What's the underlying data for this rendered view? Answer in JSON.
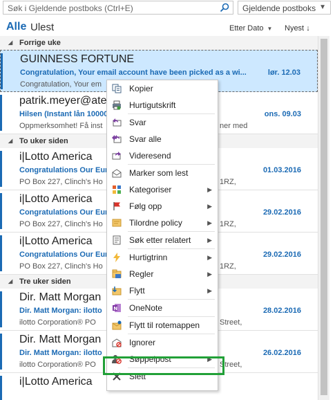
{
  "search": {
    "placeholder": "Søk i Gjeldende postboks (Ctrl+E)",
    "scope": "Gjeldende postboks"
  },
  "filters": {
    "all": "Alle",
    "unread": "Ulest",
    "sort_by": "Etter Dato",
    "sort_order": "Nyest"
  },
  "groups": [
    "Forrige uke",
    "To uker siden",
    "Tre uker siden"
  ],
  "emails": [
    {
      "sender": "GUINNESS FORTUNE",
      "subject": "Congratulation, Your email account have been picked as a wi...",
      "date": "lør. 12.03",
      "preview": "Congratulation, Your em",
      "preview_right": ""
    },
    {
      "sender": "patrik.meyer@atelie",
      "subject": "Hilsen (Instant lån 10000",
      "date": "ons. 09.03",
      "preview": "Oppmerksomhet! Få inst",
      "preview_right": "ner med"
    },
    {
      "sender": "i|Lotto America",
      "subject": "Congratulations Our Eur",
      "date": "01.03.2016",
      "preview": "PO Box 227,  Clinch's Ho",
      "preview_right": "1RZ,"
    },
    {
      "sender": "i|Lotto America",
      "subject": "Congratulations Our Eur",
      "date": "29.02.2016",
      "preview": "PO Box 227,  Clinch's Ho",
      "preview_right": "1RZ,"
    },
    {
      "sender": "i|Lotto America",
      "subject": "Congratulations Our Eur",
      "date": "29.02.2016",
      "preview": "PO Box 227,  Clinch's Ho",
      "preview_right": "1RZ,"
    },
    {
      "sender": "Dir. Matt Morgan",
      "subject": "Dir. Matt Morgan: ilotto",
      "date": "28.02.2016",
      "preview": "ilotto Corporation®   PO",
      "preview_right": "Street,"
    },
    {
      "sender": "Dir. Matt Morgan",
      "subject": "Dir. Matt Morgan: ilotto",
      "date": "26.02.2016",
      "preview": "ilotto Corporation®   PO",
      "preview_right": "Street,"
    },
    {
      "sender": "i|Lotto America",
      "subject": "",
      "date": "",
      "preview": "",
      "preview_right": ""
    }
  ],
  "menu": [
    {
      "label": "Kopier",
      "icon": "copy-icon",
      "submenu": false
    },
    {
      "label": "Hurtigutskrift",
      "icon": "print-icon",
      "submenu": false
    },
    {
      "label": "Svar",
      "icon": "reply-icon",
      "submenu": false
    },
    {
      "label": "Svar alle",
      "icon": "reply-all-icon",
      "submenu": false
    },
    {
      "label": "Videresend",
      "icon": "forward-icon",
      "submenu": false
    },
    {
      "label": "Marker som lest",
      "icon": "mark-read-icon",
      "submenu": false
    },
    {
      "label": "Kategoriser",
      "icon": "categorize-icon",
      "submenu": true
    },
    {
      "label": "Følg opp",
      "icon": "flag-icon",
      "submenu": true
    },
    {
      "label": "Tilordne policy",
      "icon": "policy-icon",
      "submenu": true
    },
    {
      "label": "Søk etter relatert",
      "icon": "find-related-icon",
      "submenu": true
    },
    {
      "label": "Hurtigtrinn",
      "icon": "quick-steps-icon",
      "submenu": true
    },
    {
      "label": "Regler",
      "icon": "rules-icon",
      "submenu": true
    },
    {
      "label": "Flytt",
      "icon": "move-icon",
      "submenu": true
    },
    {
      "label": "OneNote",
      "icon": "onenote-icon",
      "submenu": false
    },
    {
      "label": "Flytt til rotemappen",
      "icon": "clutter-icon",
      "submenu": false
    },
    {
      "label": "Ignorer",
      "icon": "ignore-icon",
      "submenu": false
    },
    {
      "label": "Søppelpost",
      "icon": "junk-icon",
      "submenu": true
    },
    {
      "label": "Slett",
      "icon": "delete-icon",
      "submenu": false
    }
  ],
  "colors": {
    "accent": "#1b6ab4",
    "selected_bg": "#cde8ff",
    "highlight": "#21a037"
  }
}
